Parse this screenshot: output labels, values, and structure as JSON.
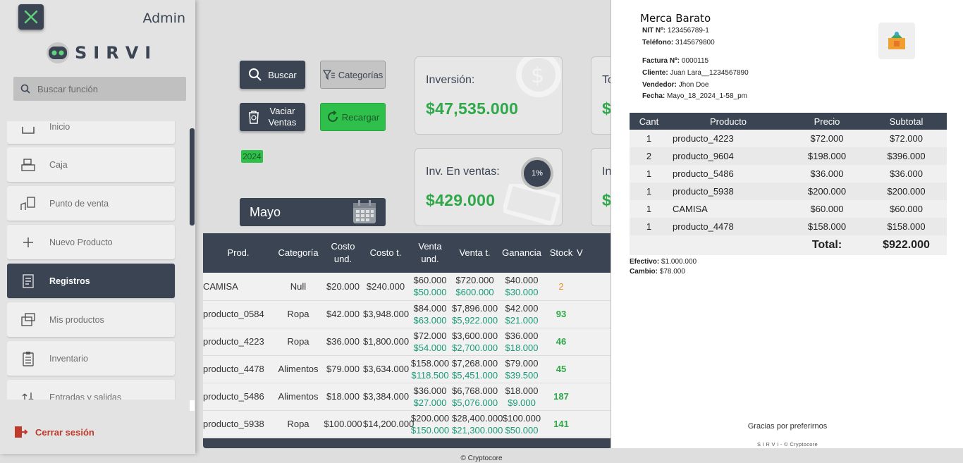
{
  "sidebar": {
    "admin_label": "Admin",
    "logo_text": "SIRVI",
    "search_placeholder": "Buscar función",
    "items": [
      {
        "label": "Inicio",
        "icon": "home-icon"
      },
      {
        "label": "Caja",
        "icon": "cash-register-icon"
      },
      {
        "label": "Punto de venta",
        "icon": "point-of-sale-icon"
      },
      {
        "label": "Nuevo Producto",
        "icon": "plus-icon"
      },
      {
        "label": "Registros",
        "icon": "records-icon",
        "active": true
      },
      {
        "label": "Mis productos",
        "icon": "products-icon"
      },
      {
        "label": "Inventario",
        "icon": "clipboard-icon"
      },
      {
        "label": "Entradas y salidas",
        "icon": "in-out-icon"
      }
    ],
    "logout_label": "Cerrar sesión"
  },
  "toolbar": {
    "search_label": "Buscar",
    "categories_label": "Categorías",
    "empty_sales_label": "Vaciar Ventas",
    "reload_label": "Recargar",
    "year": "2024",
    "month": "Mayo"
  },
  "cards": {
    "investment_label": "Inversión:",
    "investment_value": "$47,535.000",
    "inv_sales_label": "Inv. En ventas:",
    "inv_sales_value": "$429.000",
    "inv_sales_percent": "1%",
    "card3_label_partial": "To",
    "card3_value_partial": "$",
    "card4_label_partial": "In",
    "card4_value_partial": "$"
  },
  "table": {
    "headers": [
      "Prod.",
      "Categoría",
      "Costo und.",
      "Costo t.",
      "Venta und.",
      "Venta t.",
      "Ganancia",
      "Stock",
      "V"
    ],
    "rows": [
      {
        "prod": "CAMISA",
        "cat": "Null",
        "cu": "$20.000",
        "ct": "$240.000",
        "vu": "$60.000",
        "vu2": "$50.000",
        "vt": "$720.000",
        "vt2": "$600.000",
        "g": "$40.000",
        "g2": "$30.000",
        "stock": "2"
      },
      {
        "prod": "producto_0584",
        "cat": "Ropa",
        "cu": "$42.000",
        "ct": "$3,948.000",
        "vu": "$84.000",
        "vu2": "$63.000",
        "vt": "$7,896.000",
        "vt2": "$5,922.000",
        "g": "$42.000",
        "g2": "$21.000",
        "stock": "93"
      },
      {
        "prod": "producto_4223",
        "cat": "Ropa",
        "cu": "$36.000",
        "ct": "$1,800.000",
        "vu": "$72.000",
        "vu2": "$54.000",
        "vt": "$3,600.000",
        "vt2": "$2,700.000",
        "g": "$36.000",
        "g2": "$18.000",
        "stock": "46"
      },
      {
        "prod": "producto_4478",
        "cat": "Alimentos",
        "cu": "$79.000",
        "ct": "$3,634.000",
        "vu": "$158.000",
        "vu2": "$118.500",
        "vt": "$7,268.000",
        "vt2": "$5,451.000",
        "g": "$79.000",
        "g2": "$39.500",
        "stock": "45"
      },
      {
        "prod": "producto_5486",
        "cat": "Alimentos",
        "cu": "$18.000",
        "ct": "$3,384.000",
        "vu": "$36.000",
        "vu2": "$27.000",
        "vt": "$6,768.000",
        "vt2": "$5,076.000",
        "g": "$18.000",
        "g2": "$9.000",
        "stock": "187"
      },
      {
        "prod": "producto_5938",
        "cat": "Ropa",
        "cu": "$100.000",
        "ct": "$14,200.000",
        "vu": "$200.000",
        "vu2": "$150.000",
        "vt": "$28,400.000",
        "vt2": "$21,300.000",
        "g": "$100.000",
        "g2": "$50.000",
        "stock": "141"
      }
    ]
  },
  "receipt": {
    "shop_name": "Merca Barato",
    "nit_label": "NIT Nº:",
    "nit": "123456789-1",
    "phone_label": "Teléfono:",
    "phone": "3145679800",
    "invoice_label": "Factura Nº:",
    "invoice": "0000115",
    "client_label": "Cliente:",
    "client": "Juan Lara__1234567890",
    "seller_label": "Vendedor:",
    "seller": "Jhon Doe",
    "date_label": "Fecha:",
    "date": "Mayo_18_2024_1-58_pm",
    "headers": [
      "Cant",
      "Producto",
      "Precio",
      "Subtotal"
    ],
    "items": [
      {
        "qty": "1",
        "product": "producto_4223",
        "price": "$72.000",
        "subtotal": "$72.000"
      },
      {
        "qty": "2",
        "product": "producto_9604",
        "price": "$198.000",
        "subtotal": "$396.000"
      },
      {
        "qty": "1",
        "product": "producto_5486",
        "price": "$36.000",
        "subtotal": "$36.000"
      },
      {
        "qty": "1",
        "product": "producto_5938",
        "price": "$200.000",
        "subtotal": "$200.000"
      },
      {
        "qty": "1",
        "product": "CAMISA",
        "price": "$60.000",
        "subtotal": "$60.000"
      },
      {
        "qty": "1",
        "product": "producto_4478",
        "price": "$158.000",
        "subtotal": "$158.000"
      }
    ],
    "total_label": "Total:",
    "total": "$922.000",
    "cash_label": "Efectivo:",
    "cash": "$1.000.000",
    "change_label": "Cambio:",
    "change": "$78.000",
    "thanks": "Gracias por preferirnos",
    "footer": "S I R V I - © Cryptocore"
  },
  "footer": "© Cryptocore",
  "colors": {
    "dark": "#3b4453",
    "green": "#2fc04c",
    "money": "#2fa84a",
    "teal": "#1a9a78",
    "danger": "#c0392b"
  }
}
